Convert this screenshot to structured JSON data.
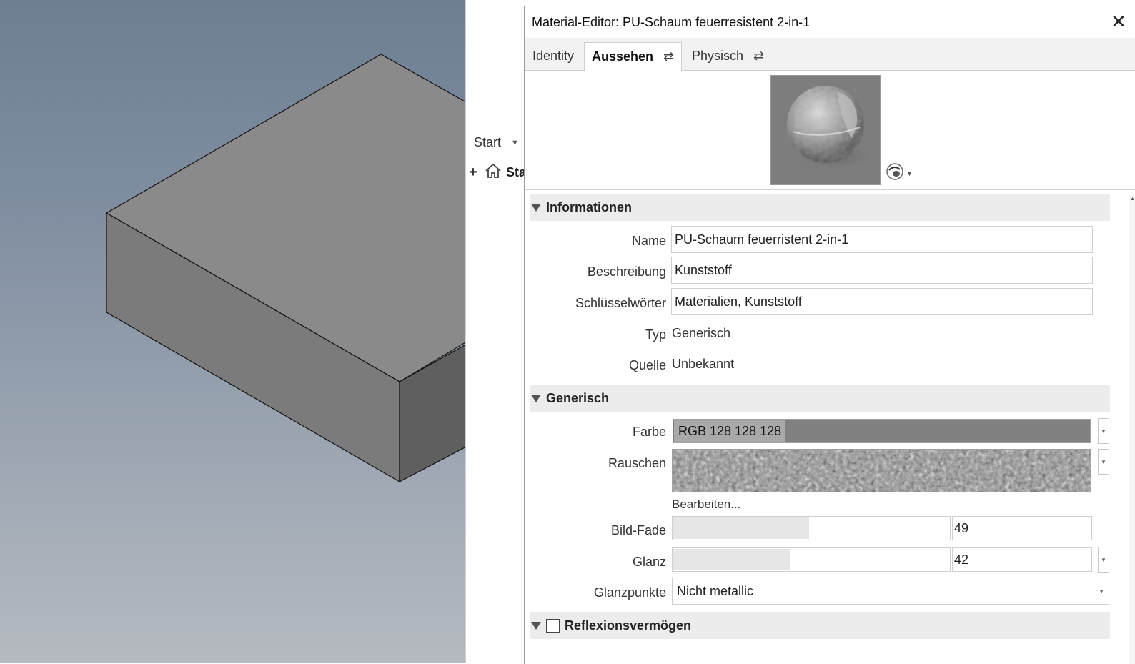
{
  "viewport": {
    "background_top": "#6e7f93",
    "background_bottom": "#b5bac0",
    "part_color_top": "#8a8a8a",
    "part_color_front": "#7a7a7a",
    "part_color_side": "#5e5e5e"
  },
  "browser": {
    "start_label": "Start",
    "tree_item_label": "Sta"
  },
  "dialog": {
    "title": "Material-Editor: PU-Schaum feuerresistent 2-in-1",
    "tabs": [
      {
        "label": "Identity"
      },
      {
        "label": "Aussehen",
        "active": true
      },
      {
        "label": "Physisch"
      }
    ]
  },
  "sections": {
    "info": {
      "title": "Informationen",
      "name_label": "Name",
      "name_value": "PU-Schaum feuerristent 2-in-1",
      "desc_label": "Beschreibung",
      "desc_value": "Kunststoff",
      "keywords_label": "Schlüsselwörter",
      "keywords_value": "Materialien, Kunststoff",
      "type_label": "Typ",
      "type_value": "Generisch",
      "source_label": "Quelle",
      "source_value": "Unbekannt"
    },
    "generic": {
      "title": "Generisch",
      "color_label": "Farbe",
      "color_value": "RGB 128 128 128",
      "color_hex": "#808080",
      "noise_label": "Rauschen",
      "edit_link": "Bearbeiten...",
      "fade_label": "Bild-Fade",
      "fade_value": "49",
      "fade_fraction": 0.49,
      "gloss_label": "Glanz",
      "gloss_value": "42",
      "gloss_fraction": 0.42,
      "highlights_label": "Glanzpunkte",
      "highlights_value": "Nicht metallic"
    },
    "reflect": {
      "title": "Reflexionsvermögen",
      "enabled": false
    }
  },
  "icons": {
    "close": "close-icon",
    "swap": "swap-arrows-icon",
    "home": "home-icon",
    "preview": "sphere-preview-icon"
  }
}
